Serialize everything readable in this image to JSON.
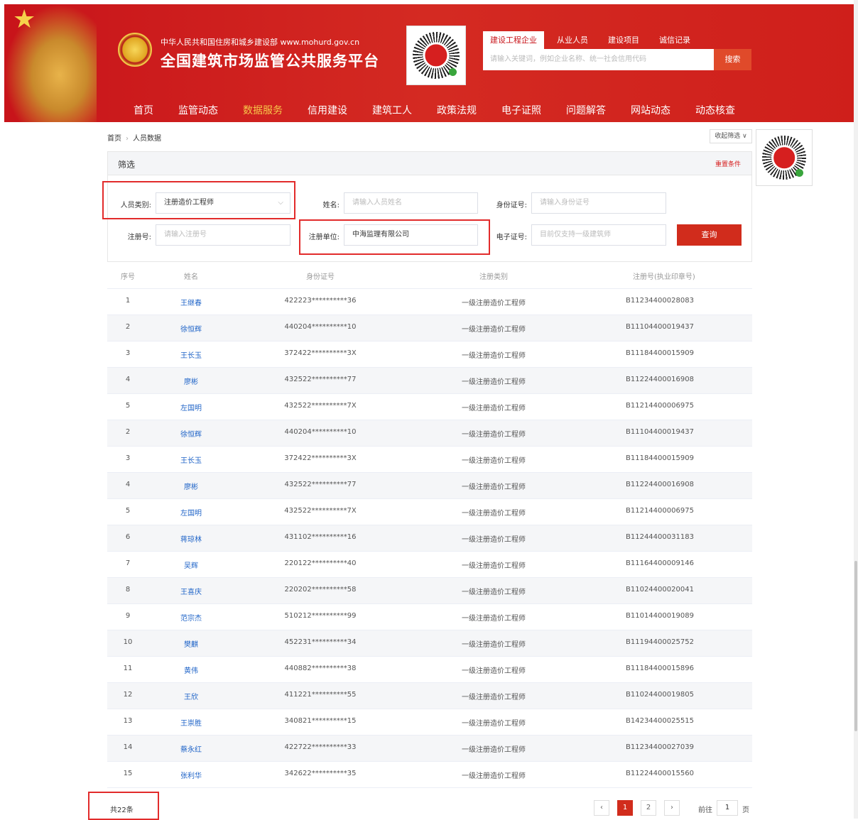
{
  "header": {
    "ministry": "中华人民共和国住房和城乡建设部  www.mohurd.gov.cn",
    "platform_title": "全国建筑市场监管公共服务平台",
    "search_tabs": [
      "建设工程企业",
      "从业人员",
      "建设项目",
      "诚信记录"
    ],
    "search_placeholder": "请输入关键词，例如企业名称、统一社会信用代码",
    "search_button": "搜索",
    "nav": [
      "首页",
      "监管动态",
      "数据服务",
      "信用建设",
      "建筑工人",
      "政策法规",
      "电子证照",
      "问题解答",
      "网站动态",
      "动态核查"
    ],
    "nav_active": "数据服务"
  },
  "breadcrumb": {
    "home": "首页",
    "current": "人员数据"
  },
  "collapse_label": "收起筛选 ∨",
  "filter": {
    "title": "筛选",
    "reset": "重置条件",
    "person_type_label": "人员类别:",
    "person_type_value": "注册造价工程师",
    "name_label": "姓名:",
    "name_placeholder": "请输入人员姓名",
    "id_label": "身份证号:",
    "id_placeholder": "请输入身份证号",
    "reg_no_label": "注册号:",
    "reg_no_placeholder": "请输入注册号",
    "reg_unit_label": "注册单位:",
    "reg_unit_value": "中海监理有限公司",
    "cert_label": "电子证号:",
    "cert_placeholder": "目前仅支持一级建筑师",
    "query_button": "查询"
  },
  "table": {
    "headers": [
      "序号",
      "姓名",
      "身份证号",
      "注册类别",
      "注册号(执业印章号)"
    ],
    "rows": [
      [
        "1",
        "王继春",
        "422223**********36",
        "一级注册造价工程师",
        "B11234400028083"
      ],
      [
        "2",
        "徐恒辉",
        "440204**********10",
        "一级注册造价工程师",
        "B11104400019437"
      ],
      [
        "3",
        "王长玉",
        "372422**********3X",
        "一级注册造价工程师",
        "B11184400015909"
      ],
      [
        "4",
        "廖彬",
        "432522**********77",
        "一级注册造价工程师",
        "B11224400016908"
      ],
      [
        "5",
        "左国明",
        "432522**********7X",
        "一级注册造价工程师",
        "B11214400006975"
      ],
      [
        "2",
        "徐恒辉",
        "440204**********10",
        "一级注册造价工程师",
        "B11104400019437"
      ],
      [
        "3",
        "王长玉",
        "372422**********3X",
        "一级注册造价工程师",
        "B11184400015909"
      ],
      [
        "4",
        "廖彬",
        "432522**********77",
        "一级注册造价工程师",
        "B11224400016908"
      ],
      [
        "5",
        "左国明",
        "432522**********7X",
        "一级注册造价工程师",
        "B11214400006975"
      ],
      [
        "6",
        "蒋琼林",
        "431102**********16",
        "一级注册造价工程师",
        "B11244400031183"
      ],
      [
        "7",
        "吴辉",
        "220122**********40",
        "一级注册造价工程师",
        "B11164400009146"
      ],
      [
        "8",
        "王喜庆",
        "220202**********58",
        "一级注册造价工程师",
        "B11024400020041"
      ],
      [
        "9",
        "范宗杰",
        "510212**********99",
        "一级注册造价工程师",
        "B11014400019089"
      ],
      [
        "10",
        "樊麒",
        "452231**********34",
        "一级注册造价工程师",
        "B11194400025752"
      ],
      [
        "11",
        "黄伟",
        "440882**********38",
        "一级注册造价工程师",
        "B11184400015896"
      ],
      [
        "12",
        "王欣",
        "411221**********55",
        "一级注册造价工程师",
        "B11024400019805"
      ],
      [
        "13",
        "王崇胜",
        "340821**********15",
        "一级注册造价工程师",
        "B14234400025515"
      ],
      [
        "14",
        "蔡永红",
        "422722**********33",
        "一级注册造价工程师",
        "B11234400027039"
      ],
      [
        "15",
        "张利华",
        "342622**********35",
        "一级注册造价工程师",
        "B11224400015560"
      ]
    ]
  },
  "pagination": {
    "total": "共22条",
    "prev": "‹",
    "pages": [
      "1",
      "2"
    ],
    "next": "›",
    "goto_prefix": "前往",
    "goto_value": "1",
    "goto_suffix": "页"
  },
  "colors": {
    "brand_red": "#c8141a",
    "accent_gold": "#f7c74a",
    "link_blue": "#2165c8"
  }
}
